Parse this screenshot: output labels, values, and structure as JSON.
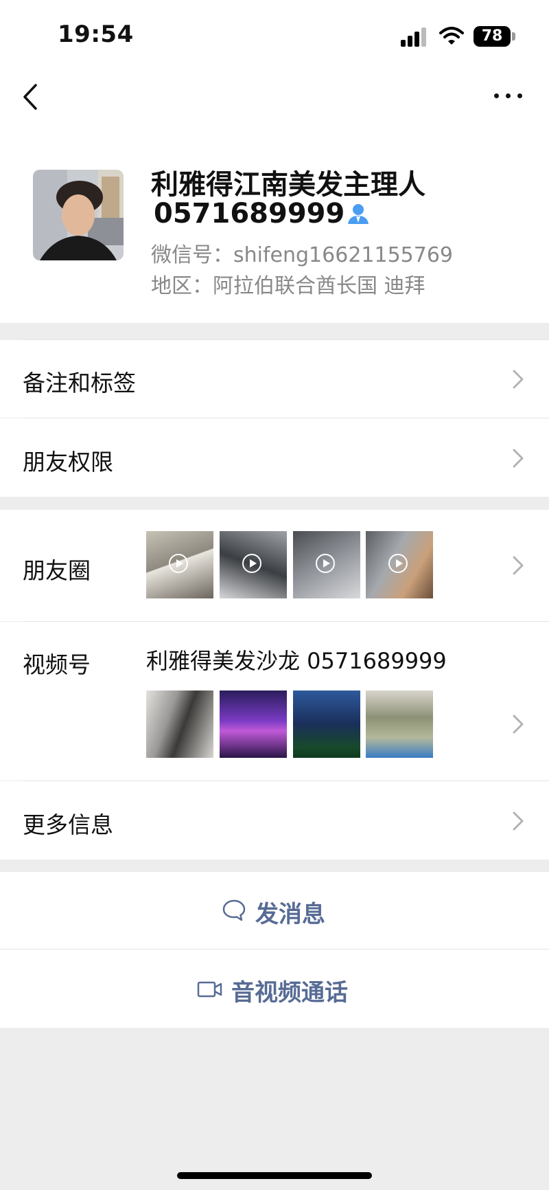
{
  "status_bar": {
    "time": "19:54",
    "battery": "78"
  },
  "profile": {
    "name_line1": "利雅得江南美发主理人",
    "name_line2": "0571689999",
    "wechat_id": "微信号：shifeng16621155769",
    "region": "地区：阿拉伯联合酋长国 迪拜"
  },
  "menu": {
    "remarks_tags": "备注和标签",
    "friend_permissions": "朋友权限",
    "moments": "朋友圈",
    "channels": "视频号",
    "channels_name": "利雅得美发沙龙 0571689999",
    "more_info": "更多信息"
  },
  "actions": {
    "send_message": "发消息",
    "video_call": "音视频通话"
  },
  "icons": [
    "back-icon",
    "more-icon",
    "verified-person-icon",
    "chevron-right-icon",
    "play-icon",
    "chat-bubble-icon",
    "video-camera-icon"
  ],
  "colors": {
    "link_blue": "#576b95",
    "person_icon": "#4a9df0",
    "background": "#ededed"
  }
}
